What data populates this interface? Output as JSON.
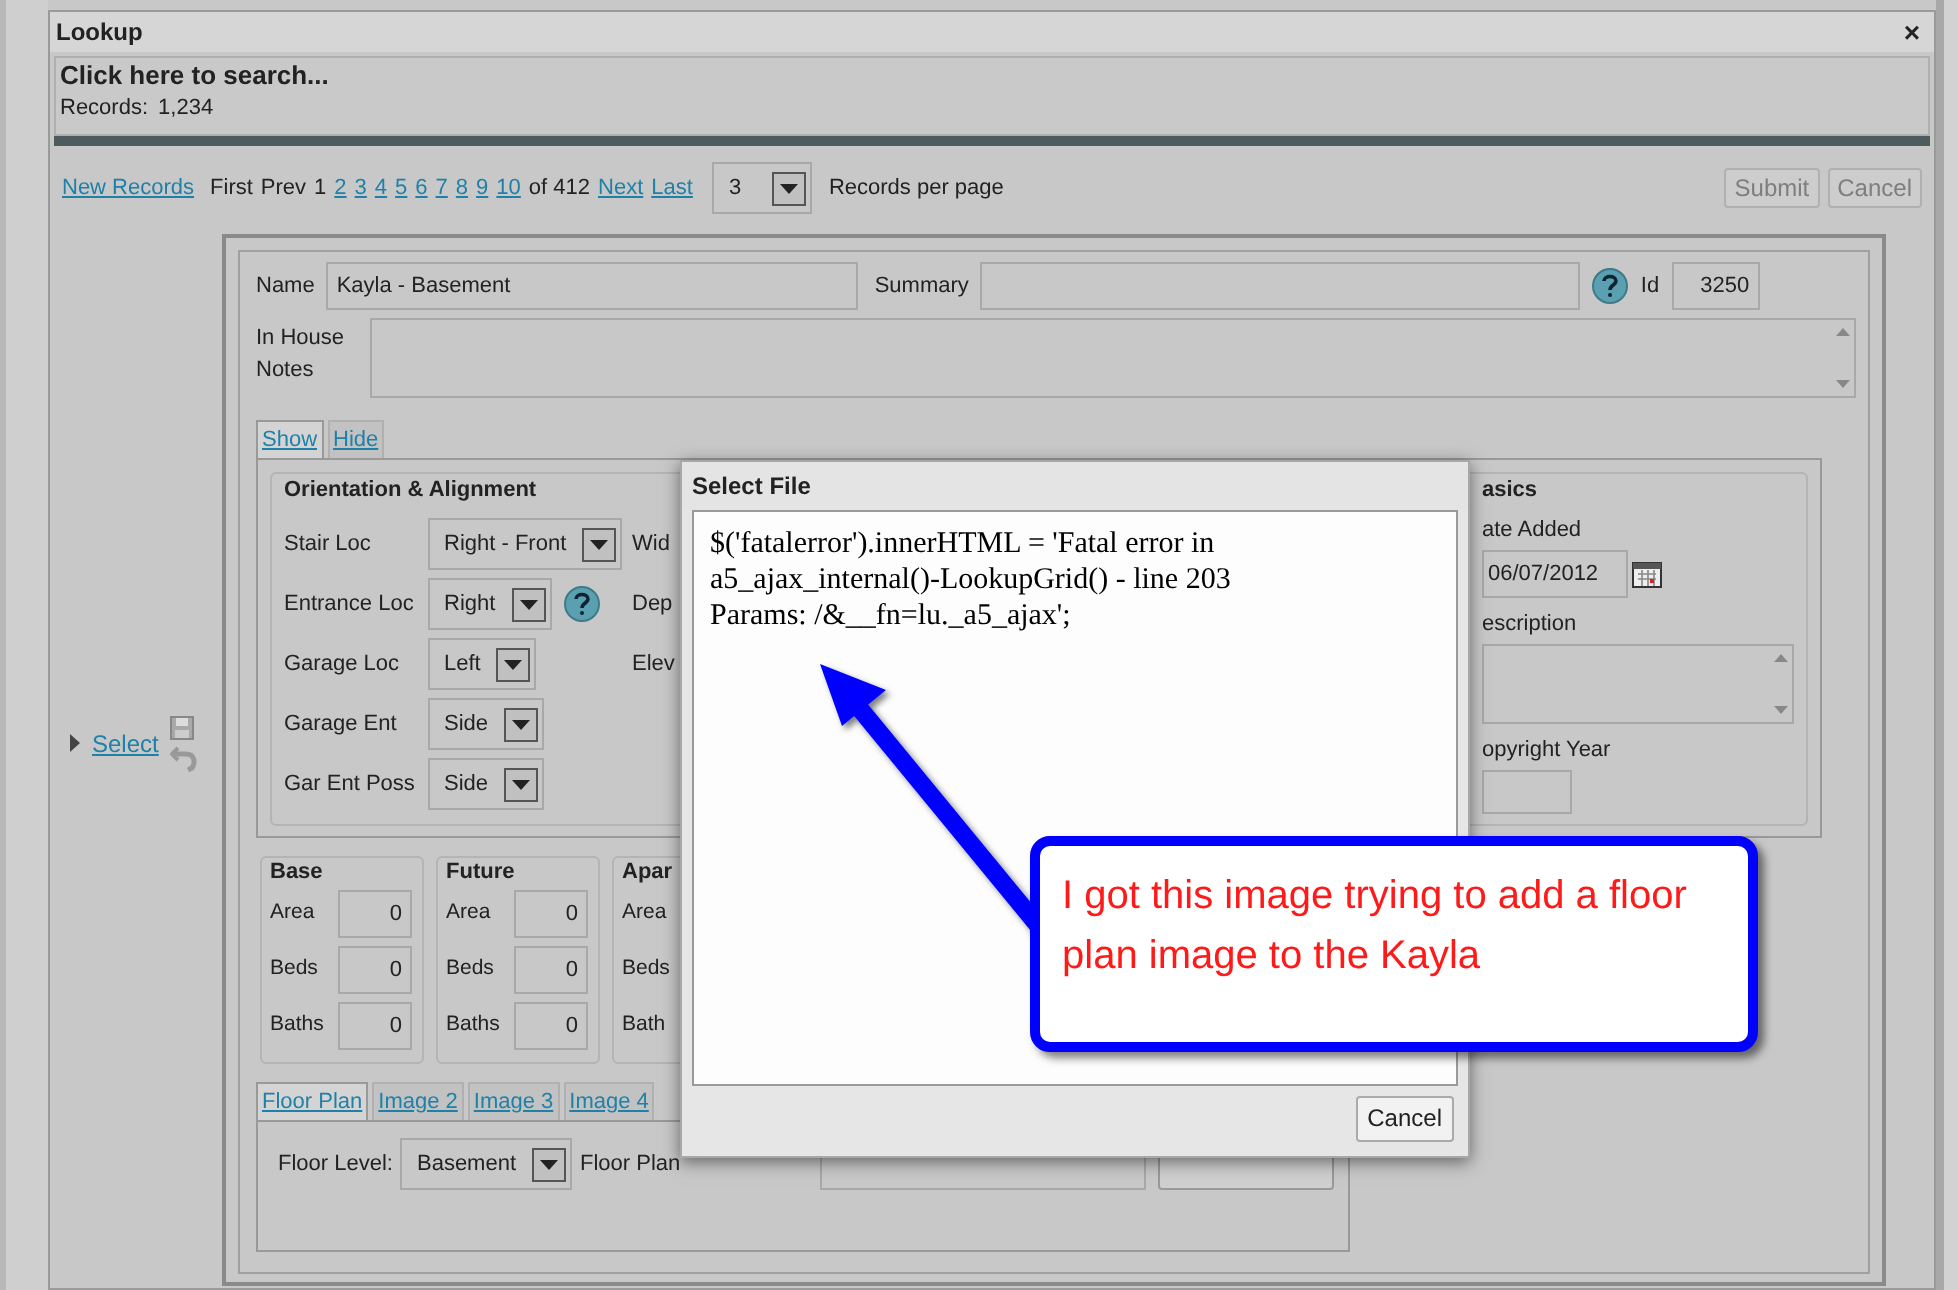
{
  "window": {
    "title": "Lookup",
    "close": "×"
  },
  "search": {
    "prompt": "Click here to search...",
    "records_label": "Records:",
    "records_count": "1,234"
  },
  "toolbar": {
    "new_records": "New Records",
    "pager": [
      {
        "label": "First",
        "link": false
      },
      {
        "label": "Prev",
        "link": false
      },
      {
        "label": "1",
        "link": false
      },
      {
        "label": "2",
        "link": true
      },
      {
        "label": "3",
        "link": true
      },
      {
        "label": "4",
        "link": true
      },
      {
        "label": "5",
        "link": true
      },
      {
        "label": "6",
        "link": true
      },
      {
        "label": "7",
        "link": true
      },
      {
        "label": "8",
        "link": true
      },
      {
        "label": "9",
        "link": true
      },
      {
        "label": "10",
        "link": true
      },
      {
        "label": "of 412",
        "link": false
      },
      {
        "label": "Next",
        "link": true
      },
      {
        "label": "Last",
        "link": true
      }
    ],
    "per_page": {
      "value": "3",
      "label": "Records per page"
    },
    "buttons": [
      {
        "label": "Submit",
        "disabled": true
      },
      {
        "label": "Cancel",
        "disabled": true
      }
    ]
  },
  "row_action": {
    "label": "Select"
  },
  "form": {
    "name_label": "Name",
    "name_value": "Kayla - Basement",
    "summary_label": "Summary",
    "id_label": "Id",
    "id_value": "3250",
    "notes_label": "In House Notes"
  },
  "view_tabs": [
    {
      "label": "Show",
      "selected": true
    },
    {
      "label": "Hide",
      "selected": false
    }
  ],
  "orientation": {
    "title": "Orientation & Alignment",
    "fields": [
      {
        "label": "Stair Loc",
        "value": "Right - Front",
        "help": false
      },
      {
        "label": "Entrance Loc",
        "value": "Right",
        "help": true
      },
      {
        "label": "Garage Loc",
        "value": "Left",
        "help": false
      },
      {
        "label": "Garage Ent",
        "value": "Side",
        "help": false
      },
      {
        "label": "Gar Ent Poss",
        "value": "Side",
        "help": false
      }
    ],
    "more_labels": [
      "Wid",
      "Dep",
      "Elev"
    ]
  },
  "basics": {
    "title": "asics",
    "fields": [
      {
        "kind": "date",
        "label": "ate Added",
        "value": "06/07/2012"
      },
      {
        "kind": "textarea",
        "label": "escription"
      },
      {
        "kind": "text",
        "label": "opyright Year"
      }
    ]
  },
  "groups": [
    {
      "title": "Base",
      "fields": [
        {
          "label": "Area",
          "value": "0"
        },
        {
          "label": "Beds",
          "value": "0"
        },
        {
          "label": "Baths",
          "value": "0"
        }
      ]
    },
    {
      "title": "Future",
      "fields": [
        {
          "label": "Area",
          "value": "0"
        },
        {
          "label": "Beds",
          "value": "0"
        },
        {
          "label": "Baths",
          "value": "0"
        }
      ]
    },
    {
      "title": "Apar",
      "fields": [
        {
          "label": "Area"
        },
        {
          "label": "Beds"
        },
        {
          "label": "Bath"
        }
      ]
    }
  ],
  "image_tabs": [
    {
      "label": "Floor Plan",
      "selected": true
    },
    {
      "label": "Image 2",
      "selected": false
    },
    {
      "label": "Image 3",
      "selected": false
    },
    {
      "label": "Image 4",
      "selected": false
    }
  ],
  "floor": {
    "level_label": "Floor Level:",
    "level_value": "Basement",
    "plan_label": "Floor Plan"
  },
  "dialog": {
    "title": "Select File",
    "lines": [
      "$('fatalerror').innerHTML = 'Fatal error in",
      "a5_ajax_internal()-LookupGrid() - line 203",
      "Params: /&__fn=lu._a5_ajax';"
    ],
    "cancel": "Cancel"
  },
  "annotation": {
    "text": "I got this image trying to add a floor plan image to the Kayla"
  }
}
